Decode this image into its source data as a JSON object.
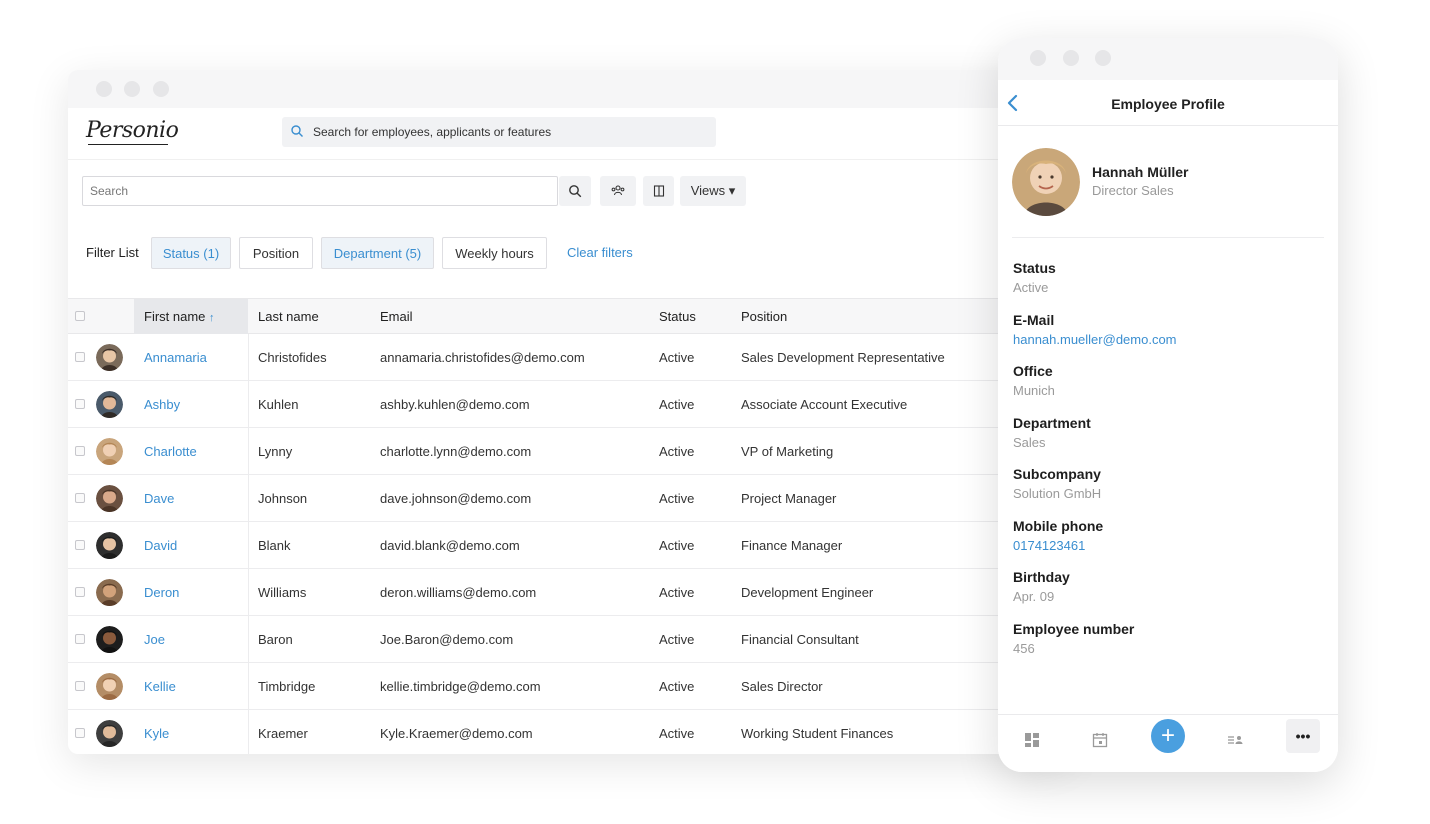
{
  "app": {
    "logo_text": "Personio",
    "global_search_placeholder": "Search for employees, applicants or features"
  },
  "toolbar": {
    "search_placeholder": "Search",
    "views_label": "Views ▾"
  },
  "filters": {
    "label": "Filter List",
    "chips": [
      {
        "label": "Status (1)",
        "active": true
      },
      {
        "label": "Position",
        "active": false
      },
      {
        "label": "Department (5)",
        "active": true
      },
      {
        "label": "Weekly hours",
        "active": false
      }
    ],
    "clear_label": "Clear filters"
  },
  "table": {
    "columns": [
      "First name",
      "Last name",
      "Email",
      "Status",
      "Position"
    ],
    "sort_indicator": "↑",
    "rows": [
      {
        "first": "Annamaria",
        "last": "Christofides",
        "email": "annamaria.christofides@demo.com",
        "status": "Active",
        "position": "Sales Development Representative"
      },
      {
        "first": "Ashby",
        "last": "Kuhlen",
        "email": "ashby.kuhlen@demo.com",
        "status": "Active",
        "position": "Associate Account Executive"
      },
      {
        "first": "Charlotte",
        "last": "Lynny",
        "email": "charlotte.lynn@demo.com",
        "status": "Active",
        "position": "VP of Marketing"
      },
      {
        "first": "Dave",
        "last": "Johnson",
        "email": "dave.johnson@demo.com",
        "status": "Active",
        "position": "Project Manager"
      },
      {
        "first": "David",
        "last": "Blank",
        "email": "david.blank@demo.com",
        "status": "Active",
        "position": "Finance Manager"
      },
      {
        "first": "Deron",
        "last": "Williams",
        "email": "deron.williams@demo.com",
        "status": "Active",
        "position": "Development Engineer"
      },
      {
        "first": "Joe",
        "last": "Baron",
        "email": "Joe.Baron@demo.com",
        "status": "Active",
        "position": "Financial Consultant"
      },
      {
        "first": "Kellie",
        "last": "Timbridge",
        "email": "kellie.timbridge@demo.com",
        "status": "Active",
        "position": "Sales Director"
      },
      {
        "first": "Kyle",
        "last": "Kraemer",
        "email": "Kyle.Kraemer@demo.com",
        "status": "Active",
        "position": "Working Student Finances"
      }
    ]
  },
  "mobile": {
    "title": "Employee Profile",
    "name": "Hannah Müller",
    "role": "Director Sales",
    "fields": [
      {
        "label": "Status",
        "value": "Active",
        "link": false
      },
      {
        "label": "E-Mail",
        "value": "hannah.mueller@demo.com",
        "link": true
      },
      {
        "label": "Office",
        "value": "Munich",
        "link": false
      },
      {
        "label": "Department",
        "value": "Sales",
        "link": false
      },
      {
        "label": "Subcompany",
        "value": "Solution GmbH",
        "link": false
      },
      {
        "label": "Mobile phone",
        "value": "0174123461",
        "link": true
      },
      {
        "label": "Birthday",
        "value": "Apr. 09",
        "link": false
      },
      {
        "label": "Employee number",
        "value": "456",
        "link": false
      }
    ],
    "more_label": "•••",
    "fab_label": "+"
  },
  "colors": {
    "accent": "#3a8ed0",
    "fab": "#4a9fdf"
  }
}
